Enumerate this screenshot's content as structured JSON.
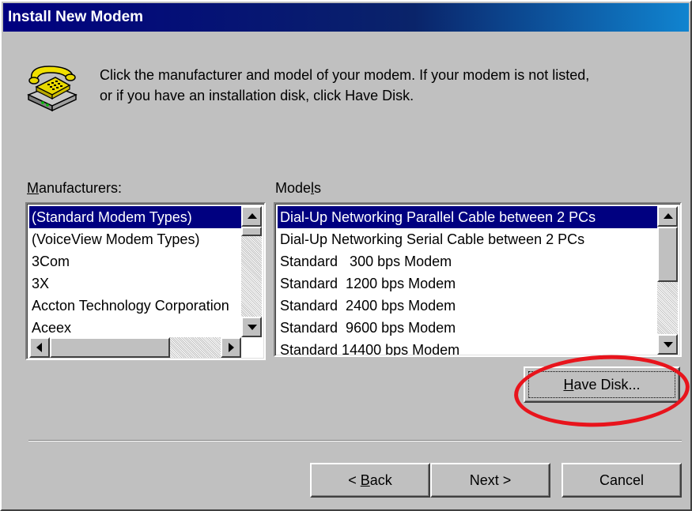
{
  "window": {
    "title": "Install New Modem"
  },
  "intro": {
    "line1": "Click the manufacturer and model of your modem. If your modem is not listed,",
    "line2": "or if you have an installation disk, click Have Disk."
  },
  "icon": "telephone-modem-icon",
  "manufacturers": {
    "label_accel": "M",
    "label_rest": "anufacturers:",
    "items": [
      "(Standard Modem Types)",
      "(VoiceView Modem Types)",
      "3Com",
      "3X",
      "Accton Technology Corporation",
      "Aceex"
    ],
    "selected_index": 0
  },
  "models": {
    "label_pre": "Mode",
    "label_accel": "l",
    "label_post": "s",
    "items": [
      "Dial-Up Networking Parallel Cable between 2 PCs",
      "Dial-Up Networking Serial Cable between 2 PCs",
      "Standard   300 bps Modem",
      "Standard  1200 bps Modem",
      "Standard  2400 bps Modem",
      "Standard  9600 bps Modem",
      "Standard 14400 bps Modem"
    ],
    "selected_index": 0
  },
  "buttons": {
    "have_disk_accel": "H",
    "have_disk_rest": "ave Disk...",
    "back_prefix": "< ",
    "back_accel": "B",
    "back_rest": "ack",
    "next": "Next >",
    "cancel": "Cancel"
  },
  "colors": {
    "face": "#c0c0c0",
    "title_bar": "#000080",
    "selection": "#000080",
    "annotation_circle": "#e8141c"
  }
}
